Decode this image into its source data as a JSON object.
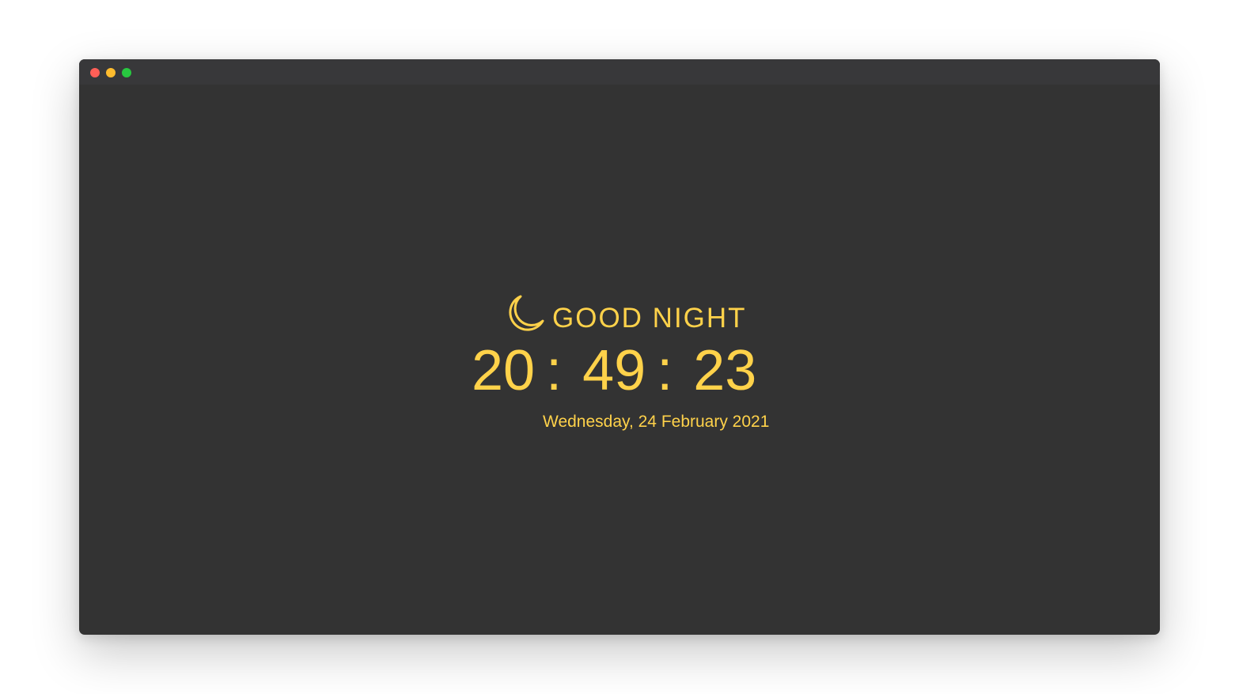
{
  "theme": {
    "window_bg": "#333333",
    "titlebar_bg": "#38383a",
    "accent": "#ffd24a",
    "traffic_close": "#ff5f57",
    "traffic_minimize": "#febc2e",
    "traffic_maximize": "#28c840"
  },
  "greeting": {
    "icon": "moon-icon",
    "text": "GOOD NIGHT"
  },
  "clock": {
    "hours": "20",
    "minutes": "49",
    "seconds": "23",
    "separator": ":"
  },
  "date": "Wednesday, 24 February 2021"
}
